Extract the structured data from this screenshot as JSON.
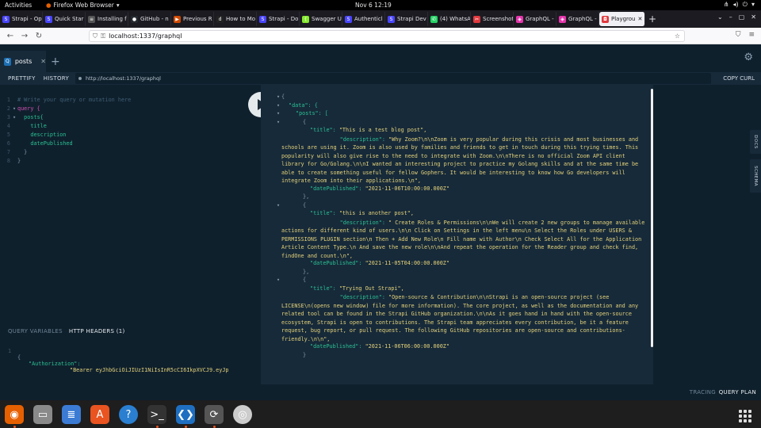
{
  "gnome": {
    "activities": "Activities",
    "app": "Firefox Web Browser",
    "clock": "Nov 6  12:19"
  },
  "tabs": [
    {
      "label": "Strapi - Op",
      "color": "#4945ff",
      "glyph": "S"
    },
    {
      "label": "Quick Star",
      "color": "#4945ff",
      "glyph": "S"
    },
    {
      "label": "Installing f",
      "color": "#555555",
      "glyph": "≡"
    },
    {
      "label": "GitHub - n",
      "color": "#24292f",
      "glyph": "●"
    },
    {
      "label": "Previous R",
      "color": "#d04a02",
      "glyph": "▶"
    },
    {
      "label": "How to Mo",
      "color": "#222222",
      "glyph": "d"
    },
    {
      "label": "Strapi - Do",
      "color": "#4945ff",
      "glyph": "S"
    },
    {
      "label": "Swagger U",
      "color": "#85ea2d",
      "glyph": "{"
    },
    {
      "label": "Authenticl",
      "color": "#4945ff",
      "glyph": "S"
    },
    {
      "label": "Strapi Dev",
      "color": "#4945ff",
      "glyph": "S"
    },
    {
      "label": "(4) WhatsA",
      "color": "#25d366",
      "glyph": "✆"
    },
    {
      "label": "Screenshot",
      "color": "#e0393e",
      "glyph": "✂"
    },
    {
      "label": "GraphQL -",
      "color": "#e535ab",
      "glyph": "◈"
    },
    {
      "label": "GraphQL -",
      "color": "#e535ab",
      "glyph": "◈"
    },
    {
      "label": "Playgrou",
      "color": "#e0393e",
      "glyph": "◘"
    }
  ],
  "nav": {
    "url": "localhost:1337/graphql"
  },
  "playground": {
    "tab_label": "posts",
    "tab_icon": "Q",
    "toolbar": {
      "prettify": "PRETTIFY",
      "history": "HISTORY",
      "endpoint": "http://localhost:1337/graphql",
      "copy_curl": "COPY CURL"
    },
    "side": {
      "docs": "DOCS",
      "schema": "SCHEMA"
    },
    "vars": {
      "query_variables": "QUERY VARIABLES",
      "http_headers": "HTTP HEADERS (1)",
      "line": "1",
      "open": "{",
      "key": "\"Authorization\":",
      "value": "\"Bearer eyJhbGciOiJIUzI1NiIsInR5cCI6IkpXVCJ9.eyJp"
    },
    "footer": {
      "tracing": "TRACING",
      "query_plan": "QUERY PLAN"
    }
  },
  "editor": {
    "lines": [
      {
        "n": "1",
        "text": "# Write your query or mutation here",
        "cls": "cm",
        "indent": 0
      },
      {
        "n": "2",
        "text": "query {",
        "cls": "kw",
        "indent": 0
      },
      {
        "n": "3",
        "text": "posts{",
        "cls": "fld",
        "indent": 1
      },
      {
        "n": "4",
        "text": "title",
        "cls": "fld",
        "indent": 2
      },
      {
        "n": "5",
        "text": "description",
        "cls": "fld",
        "indent": 2
      },
      {
        "n": "6",
        "text": "datePublished",
        "cls": "fld",
        "indent": 2
      },
      {
        "n": "7",
        "text": "}",
        "cls": "br",
        "indent": 1
      },
      {
        "n": "8",
        "text": "}",
        "cls": "br",
        "indent": 0
      }
    ]
  },
  "result": {
    "open": "{",
    "data_key": "\"data\": {",
    "posts_key": "\"posts\": [",
    "posts": [
      {
        "title_key": "\"title\":",
        "title": "\"This is a test blog post\",",
        "desc_key": "\"description\":",
        "desc": "\"Why Zoom?\\n\\nZoom is very popular during this crisis and most businesses and schools are using it. Zoom is also used by families and friends to get in touch during this trying times. This popularity will also give rise to the need to integrate with Zoom.\\n\\nThere is no official Zoom API client library for Go/Golang.\\n\\nI wanted an interesting project to practice my Golang skills and at the same time be able to create something useful for fellow Gophers.  It would be interesting to know how Go developers will integrate Zoom into their applications.\\n\",",
        "date_key": "\"datePublished\":",
        "date": "\"2021-11-06T10:00:00.000Z\""
      },
      {
        "title_key": "\"title\":",
        "title": "\"this is another post\",",
        "desc_key": "\"description\":",
        "desc": "\" Create Roles & Permissions\\n\\nWe will create 2 new groups to manage available actions for different kind of users.\\n\\n    Click on Settings in the left menu\\n    Select the Roles under USERS & PERMISSIONS PLUGIN section\\n    Then + Add New Role\\n    Fill name with Author\\n    Check Select All for the Application Article Content Type.\\n    And save the new role\\n\\nAnd repeat the operation for the Reader group and check find, findOne and count.\\n\",",
        "date_key": "\"datePublished\":",
        "date": "\"2021-11-05T04:00:00.000Z\""
      },
      {
        "title_key": "\"title\":",
        "title": "\"Trying Out Strapi\",",
        "desc_key": "\"description\":",
        "desc": "\"Open-source & Contribution\\n\\nStrapi is an open-source project (see LICENSE\\n(opens new window) file for more information). The core project, as well as the documentation and any related tool can be found in the Strapi GitHub organization.\\n\\nAs it goes hand in hand with the open-source ecosystem, Strapi is open to contributions. The Strapi team appreciates every contribution, be it a feature request, bug report, or pull request. The following GitHub repositories are open-source and contributions-friendly.\\n\\n\",",
        "date_key": "\"datePublished\":",
        "date": "\"2021-11-06T06:00:00.000Z\""
      }
    ],
    "obj_open": "{",
    "obj_close": "},",
    "last_close": "}"
  },
  "dock": [
    {
      "name": "firefox-icon",
      "color": "#e66000",
      "glyph": "◉"
    },
    {
      "name": "files-icon",
      "color": "#8a8a8a",
      "glyph": "▭"
    },
    {
      "name": "text-editor-icon",
      "color": "#3b7bd4",
      "glyph": "≣"
    },
    {
      "name": "software-store-icon",
      "color": "#e95420",
      "glyph": "A"
    },
    {
      "name": "help-icon",
      "color": "#2a7fd0",
      "glyph": "?"
    },
    {
      "name": "terminal-icon",
      "color": "#333333",
      "glyph": ">_"
    },
    {
      "name": "vscode-icon",
      "color": "#1e6fc1",
      "glyph": "❮❯"
    },
    {
      "name": "updater-icon",
      "color": "#555555",
      "glyph": "⟳"
    },
    {
      "name": "disc-icon",
      "color": "#cccccc",
      "glyph": "◎"
    }
  ]
}
